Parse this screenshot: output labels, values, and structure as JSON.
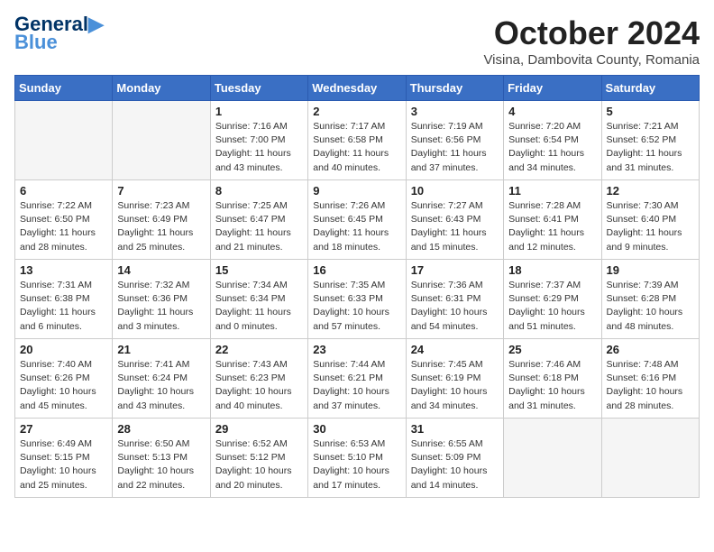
{
  "header": {
    "logo_line1": "General",
    "logo_line2": "Blue",
    "month_year": "October 2024",
    "location": "Visina, Dambovita County, Romania"
  },
  "weekdays": [
    "Sunday",
    "Monday",
    "Tuesday",
    "Wednesday",
    "Thursday",
    "Friday",
    "Saturday"
  ],
  "weeks": [
    [
      {
        "day": "",
        "empty": true
      },
      {
        "day": "",
        "empty": true
      },
      {
        "day": "1",
        "sunrise": "7:16 AM",
        "sunset": "7:00 PM",
        "daylight": "11 hours and 43 minutes."
      },
      {
        "day": "2",
        "sunrise": "7:17 AM",
        "sunset": "6:58 PM",
        "daylight": "11 hours and 40 minutes."
      },
      {
        "day": "3",
        "sunrise": "7:19 AM",
        "sunset": "6:56 PM",
        "daylight": "11 hours and 37 minutes."
      },
      {
        "day": "4",
        "sunrise": "7:20 AM",
        "sunset": "6:54 PM",
        "daylight": "11 hours and 34 minutes."
      },
      {
        "day": "5",
        "sunrise": "7:21 AM",
        "sunset": "6:52 PM",
        "daylight": "11 hours and 31 minutes."
      }
    ],
    [
      {
        "day": "6",
        "sunrise": "7:22 AM",
        "sunset": "6:50 PM",
        "daylight": "11 hours and 28 minutes."
      },
      {
        "day": "7",
        "sunrise": "7:23 AM",
        "sunset": "6:49 PM",
        "daylight": "11 hours and 25 minutes."
      },
      {
        "day": "8",
        "sunrise": "7:25 AM",
        "sunset": "6:47 PM",
        "daylight": "11 hours and 21 minutes."
      },
      {
        "day": "9",
        "sunrise": "7:26 AM",
        "sunset": "6:45 PM",
        "daylight": "11 hours and 18 minutes."
      },
      {
        "day": "10",
        "sunrise": "7:27 AM",
        "sunset": "6:43 PM",
        "daylight": "11 hours and 15 minutes."
      },
      {
        "day": "11",
        "sunrise": "7:28 AM",
        "sunset": "6:41 PM",
        "daylight": "11 hours and 12 minutes."
      },
      {
        "day": "12",
        "sunrise": "7:30 AM",
        "sunset": "6:40 PM",
        "daylight": "11 hours and 9 minutes."
      }
    ],
    [
      {
        "day": "13",
        "sunrise": "7:31 AM",
        "sunset": "6:38 PM",
        "daylight": "11 hours and 6 minutes."
      },
      {
        "day": "14",
        "sunrise": "7:32 AM",
        "sunset": "6:36 PM",
        "daylight": "11 hours and 3 minutes."
      },
      {
        "day": "15",
        "sunrise": "7:34 AM",
        "sunset": "6:34 PM",
        "daylight": "11 hours and 0 minutes."
      },
      {
        "day": "16",
        "sunrise": "7:35 AM",
        "sunset": "6:33 PM",
        "daylight": "10 hours and 57 minutes."
      },
      {
        "day": "17",
        "sunrise": "7:36 AM",
        "sunset": "6:31 PM",
        "daylight": "10 hours and 54 minutes."
      },
      {
        "day": "18",
        "sunrise": "7:37 AM",
        "sunset": "6:29 PM",
        "daylight": "10 hours and 51 minutes."
      },
      {
        "day": "19",
        "sunrise": "7:39 AM",
        "sunset": "6:28 PM",
        "daylight": "10 hours and 48 minutes."
      }
    ],
    [
      {
        "day": "20",
        "sunrise": "7:40 AM",
        "sunset": "6:26 PM",
        "daylight": "10 hours and 45 minutes."
      },
      {
        "day": "21",
        "sunrise": "7:41 AM",
        "sunset": "6:24 PM",
        "daylight": "10 hours and 43 minutes."
      },
      {
        "day": "22",
        "sunrise": "7:43 AM",
        "sunset": "6:23 PM",
        "daylight": "10 hours and 40 minutes."
      },
      {
        "day": "23",
        "sunrise": "7:44 AM",
        "sunset": "6:21 PM",
        "daylight": "10 hours and 37 minutes."
      },
      {
        "day": "24",
        "sunrise": "7:45 AM",
        "sunset": "6:19 PM",
        "daylight": "10 hours and 34 minutes."
      },
      {
        "day": "25",
        "sunrise": "7:46 AM",
        "sunset": "6:18 PM",
        "daylight": "10 hours and 31 minutes."
      },
      {
        "day": "26",
        "sunrise": "7:48 AM",
        "sunset": "6:16 PM",
        "daylight": "10 hours and 28 minutes."
      }
    ],
    [
      {
        "day": "27",
        "sunrise": "6:49 AM",
        "sunset": "5:15 PM",
        "daylight": "10 hours and 25 minutes."
      },
      {
        "day": "28",
        "sunrise": "6:50 AM",
        "sunset": "5:13 PM",
        "daylight": "10 hours and 22 minutes."
      },
      {
        "day": "29",
        "sunrise": "6:52 AM",
        "sunset": "5:12 PM",
        "daylight": "10 hours and 20 minutes."
      },
      {
        "day": "30",
        "sunrise": "6:53 AM",
        "sunset": "5:10 PM",
        "daylight": "10 hours and 17 minutes."
      },
      {
        "day": "31",
        "sunrise": "6:55 AM",
        "sunset": "5:09 PM",
        "daylight": "10 hours and 14 minutes."
      },
      {
        "day": "",
        "empty": true
      },
      {
        "day": "",
        "empty": true
      }
    ]
  ]
}
